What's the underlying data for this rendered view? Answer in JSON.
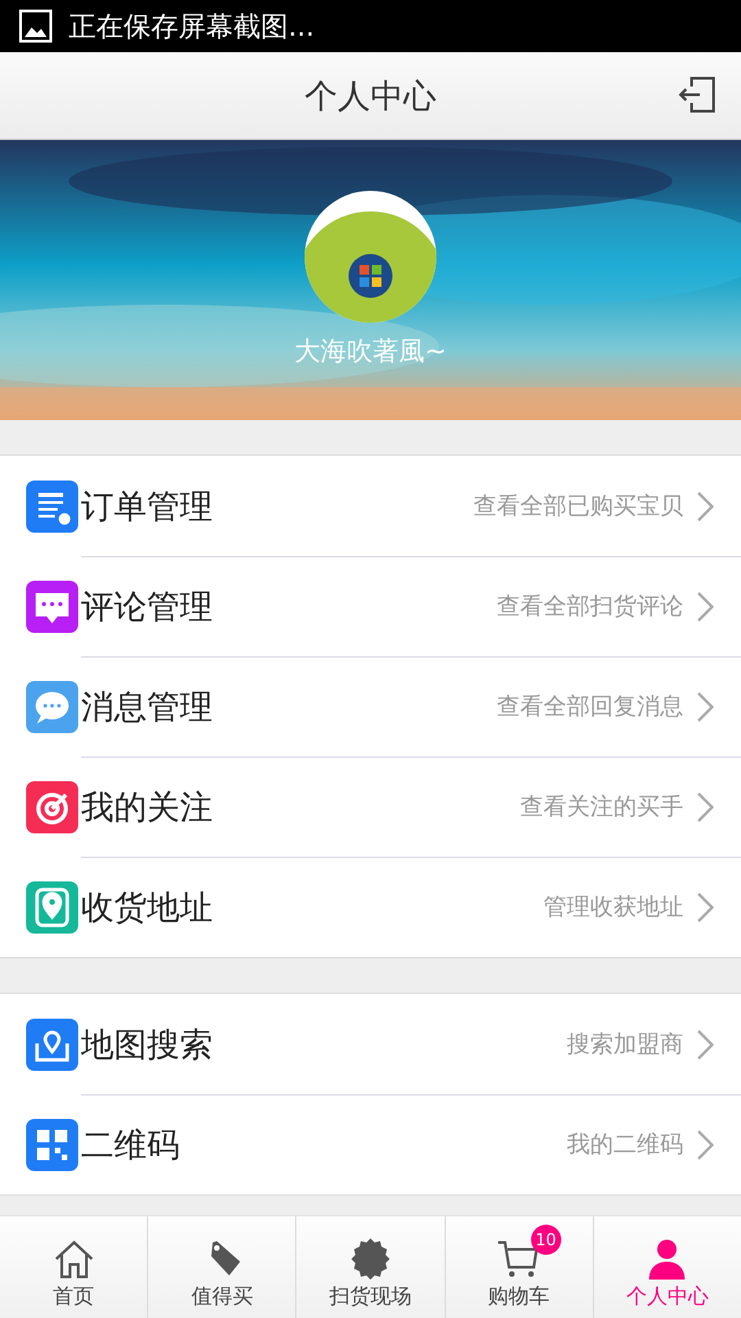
{
  "status_bar": {
    "notification": "正在保存屏幕截图..."
  },
  "header": {
    "title": "个人中心"
  },
  "profile": {
    "name": "大海吹著風~"
  },
  "menu_groups": [
    {
      "items": [
        {
          "kind": "orders",
          "title": "订单管理",
          "detail": "查看全部已购买宝贝",
          "color": "#1f7cf5"
        },
        {
          "kind": "comments",
          "title": "评论管理",
          "detail": "查看全部扫货评论",
          "color": "#b71ff5"
        },
        {
          "kind": "messages",
          "title": "消息管理",
          "detail": "查看全部回复消息",
          "color": "#4ba3ee"
        },
        {
          "kind": "follow",
          "title": "我的关注",
          "detail": "查看关注的买手",
          "color": "#f52d55"
        },
        {
          "kind": "address",
          "title": "收货地址",
          "detail": "管理收获地址",
          "color": "#16b89a"
        }
      ]
    },
    {
      "items": [
        {
          "kind": "map",
          "title": "地图搜索",
          "detail": "搜索加盟商",
          "color": "#1f7cf5"
        },
        {
          "kind": "qrcode",
          "title": "二维码",
          "detail": "我的二维码",
          "color": "#1f7cf5"
        }
      ]
    }
  ],
  "tab_bar": [
    {
      "kind": "home",
      "label": "首页",
      "selected": false
    },
    {
      "kind": "tag",
      "label": "值得买",
      "selected": false
    },
    {
      "kind": "sale",
      "label": "扫货现场",
      "selected": false
    },
    {
      "kind": "cart",
      "label": "购物车",
      "selected": false,
      "badge": "10"
    },
    {
      "kind": "person",
      "label": "个人中心",
      "selected": true
    }
  ]
}
